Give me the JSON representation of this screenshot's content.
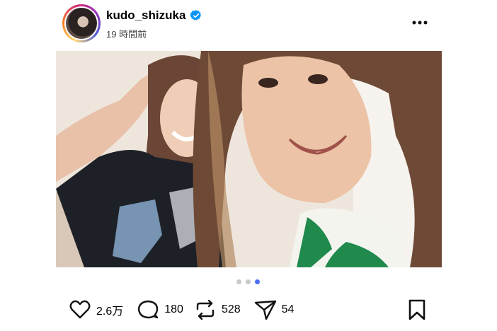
{
  "post": {
    "username": "kudo_shizuka",
    "timestamp": "19 時間前",
    "verified": true
  },
  "carousel": {
    "total": 3,
    "active_index": 2,
    "active_color": "#4a6cf7"
  },
  "actions": {
    "likes": "2.6万",
    "comments": "180",
    "reposts": "528",
    "shares": "54"
  },
  "icons": {
    "more": "more-horizontal-icon",
    "like": "heart-icon",
    "comment": "comment-icon",
    "repost": "repost-icon",
    "share": "send-icon",
    "save": "bookmark-icon",
    "verified": "verified-badge-icon"
  },
  "colors": {
    "verified_badge": "#0095f6",
    "text": "#000000",
    "muted": "#444444"
  }
}
